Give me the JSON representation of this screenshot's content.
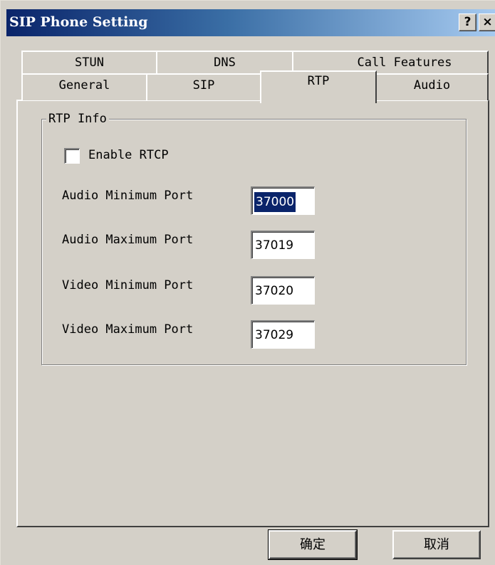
{
  "window": {
    "title": "SIP Phone Setting",
    "help_label": "?",
    "close_label": "×"
  },
  "tabs_row1": [
    {
      "label": "STUN"
    },
    {
      "label": "DNS"
    },
    {
      "label": "Call Features"
    }
  ],
  "tabs_row2": [
    {
      "label": "General"
    },
    {
      "label": "SIP"
    },
    {
      "label": "RTP",
      "active": true
    },
    {
      "label": "Audio"
    }
  ],
  "rtp": {
    "group_title": "RTP Info",
    "enable_rtcp": {
      "label": "Enable RTCP",
      "checked": false
    },
    "fields": [
      {
        "label": "Audio Minimum Port",
        "value": "37000"
      },
      {
        "label": "Audio Maximum Port",
        "value": "37019"
      },
      {
        "label": "Video Minimum Port",
        "value": "37020"
      },
      {
        "label": "Video Maximum Port",
        "value": "37029"
      }
    ]
  },
  "buttons": {
    "ok_label": "确定",
    "cancel_label": "取消"
  },
  "colors": {
    "face": "#d4d0c8",
    "title_gradient_start": "#0a246a",
    "title_gradient_end": "#a6caf0",
    "selection": "#0a246a"
  }
}
